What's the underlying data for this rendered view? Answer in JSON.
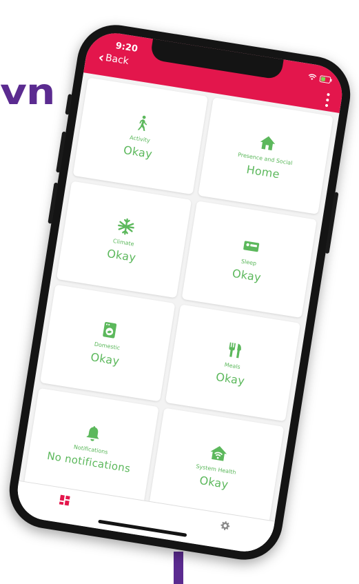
{
  "background": {
    "brand_fragment": "vn",
    "brand_color": "#5b2b90"
  },
  "status_bar": {
    "time": "9:20",
    "back_label": "Back",
    "color": "#e3164c",
    "icons": [
      "wifi-icon",
      "battery-icon"
    ]
  },
  "menu": {
    "icon": "more-vertical-icon"
  },
  "accent_color": "#5cb85c",
  "tiles": [
    {
      "id": "activity",
      "icon": "walking-person-icon",
      "label": "Activity",
      "value": "Okay"
    },
    {
      "id": "presence",
      "icon": "home-icon",
      "label": "Presence and Social",
      "value": "Home"
    },
    {
      "id": "climate",
      "icon": "snowflake-icon",
      "label": "Climate",
      "value": "Okay"
    },
    {
      "id": "sleep",
      "icon": "bed-icon",
      "label": "Sleep",
      "value": "Okay"
    },
    {
      "id": "domestic",
      "icon": "washing-machine-icon",
      "label": "Domestic",
      "value": "Okay"
    },
    {
      "id": "meals",
      "icon": "fork-knife-icon",
      "label": "Meals",
      "value": "Okay"
    },
    {
      "id": "notifications",
      "icon": "bell-icon",
      "label": "Notifications",
      "value": "No notifications"
    },
    {
      "id": "system-health",
      "icon": "home-wifi-icon",
      "label": "System Health",
      "value": "Okay"
    }
  ],
  "tab_bar": {
    "tabs": [
      {
        "id": "dashboard",
        "icon": "dashboard-grid-icon",
        "active": true,
        "color": "#e3164c"
      },
      {
        "id": "settings",
        "icon": "gear-icon",
        "active": false,
        "color": "#8a8a8a"
      }
    ]
  }
}
